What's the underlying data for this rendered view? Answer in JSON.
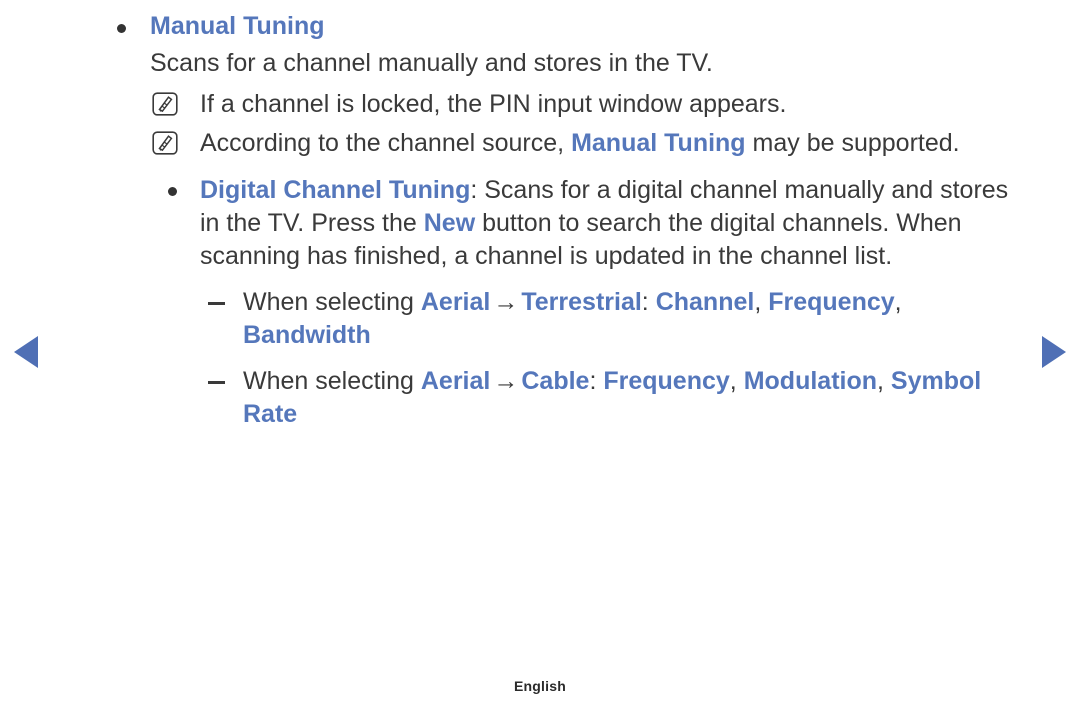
{
  "colors": {
    "accent_blue": "#5577bb",
    "nav_arrow_blue": "#4f6fb5",
    "body_text": "#3a3a3a",
    "background": "#ffffff"
  },
  "nav": {
    "prev_icon": "triangle-left-icon",
    "next_icon": "triangle-right-icon",
    "prev_label": "Previous page",
    "next_label": "Next page"
  },
  "content": {
    "section_heading": "Manual Tuning",
    "section_description": "Scans for a channel manually and stores in the TV.",
    "notes": [
      {
        "icon": "note-pencil-icon",
        "text": "If a channel is locked, the PIN input window appears."
      },
      {
        "icon": "note-pencil-icon",
        "text_before": "According to the channel source, ",
        "emphasis": "Manual Tuning",
        "text_after": " may be supported."
      }
    ],
    "digital_item": {
      "term": "Digital Channel Tuning",
      "colon": ":",
      "body_part1": " Scans for a digital channel manually and stores in the TV. Press the ",
      "emphasis": "New",
      "body_part2": " button to search the digital channels. When scanning has finished, a channel is updated in the channel list."
    },
    "sub_items": [
      {
        "prefix": "When selecting ",
        "source": "Aerial",
        "arrow": "→",
        "mode": "Terrestrial",
        "colon": ":",
        "fields": [
          "Channel",
          "Frequency",
          "Bandwidth"
        ]
      },
      {
        "prefix": "When selecting ",
        "source": "Aerial",
        "arrow": "→",
        "mode": "Cable",
        "colon": ":",
        "fields": [
          "Frequency",
          "Modulation",
          "Symbol Rate"
        ]
      }
    ]
  },
  "footer": {
    "language": "English"
  }
}
